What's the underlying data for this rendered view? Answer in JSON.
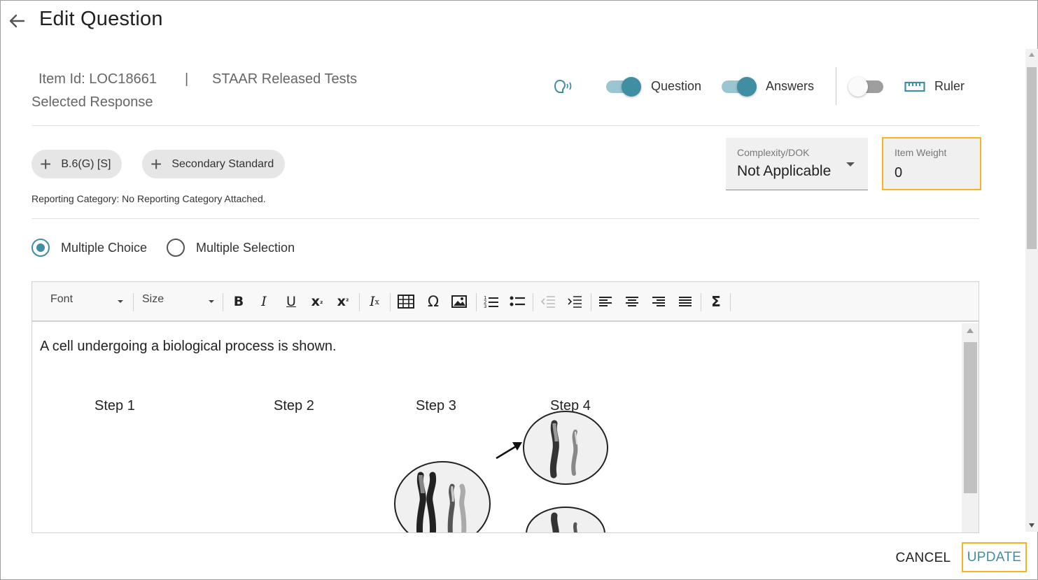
{
  "header": {
    "title": "Edit Question",
    "back_icon": "arrow-left-icon"
  },
  "item": {
    "id_text": "Item Id: LOC18661",
    "separator": "|",
    "source": "STAAR Released Tests",
    "type": "Selected Response"
  },
  "controls": {
    "tts_icon": "speaker-voice-icon",
    "question_toggle": {
      "label": "Question",
      "on": true
    },
    "answers_toggle": {
      "label": "Answers",
      "on": true
    },
    "ruler_toggle": {
      "on": false
    },
    "ruler_icon": "ruler-icon",
    "ruler_label": "Ruler"
  },
  "standards": {
    "primary_chip": "B.6(G) [S]",
    "secondary_chip": "Secondary Standard",
    "reporting": "Reporting Category: No Reporting Category Attached."
  },
  "fields": {
    "complexity": {
      "label": "Complexity/DOK",
      "value": "Not Applicable"
    },
    "item_weight": {
      "label": "Item Weight",
      "value": "0"
    }
  },
  "response_type": {
    "options": [
      "Multiple Choice",
      "Multiple Selection"
    ],
    "selected": "Multiple Choice"
  },
  "editor": {
    "font_label": "Font",
    "size_label": "Size",
    "question_text": "A cell undergoing a biological process is shown.",
    "steps": [
      "Step 1",
      "Step 2",
      "Step 3",
      "Step 4"
    ]
  },
  "footer": {
    "cancel": "CANCEL",
    "update": "UPDATE"
  },
  "colors": {
    "accent": "#3f8ea1",
    "highlight": "#f5b523"
  }
}
